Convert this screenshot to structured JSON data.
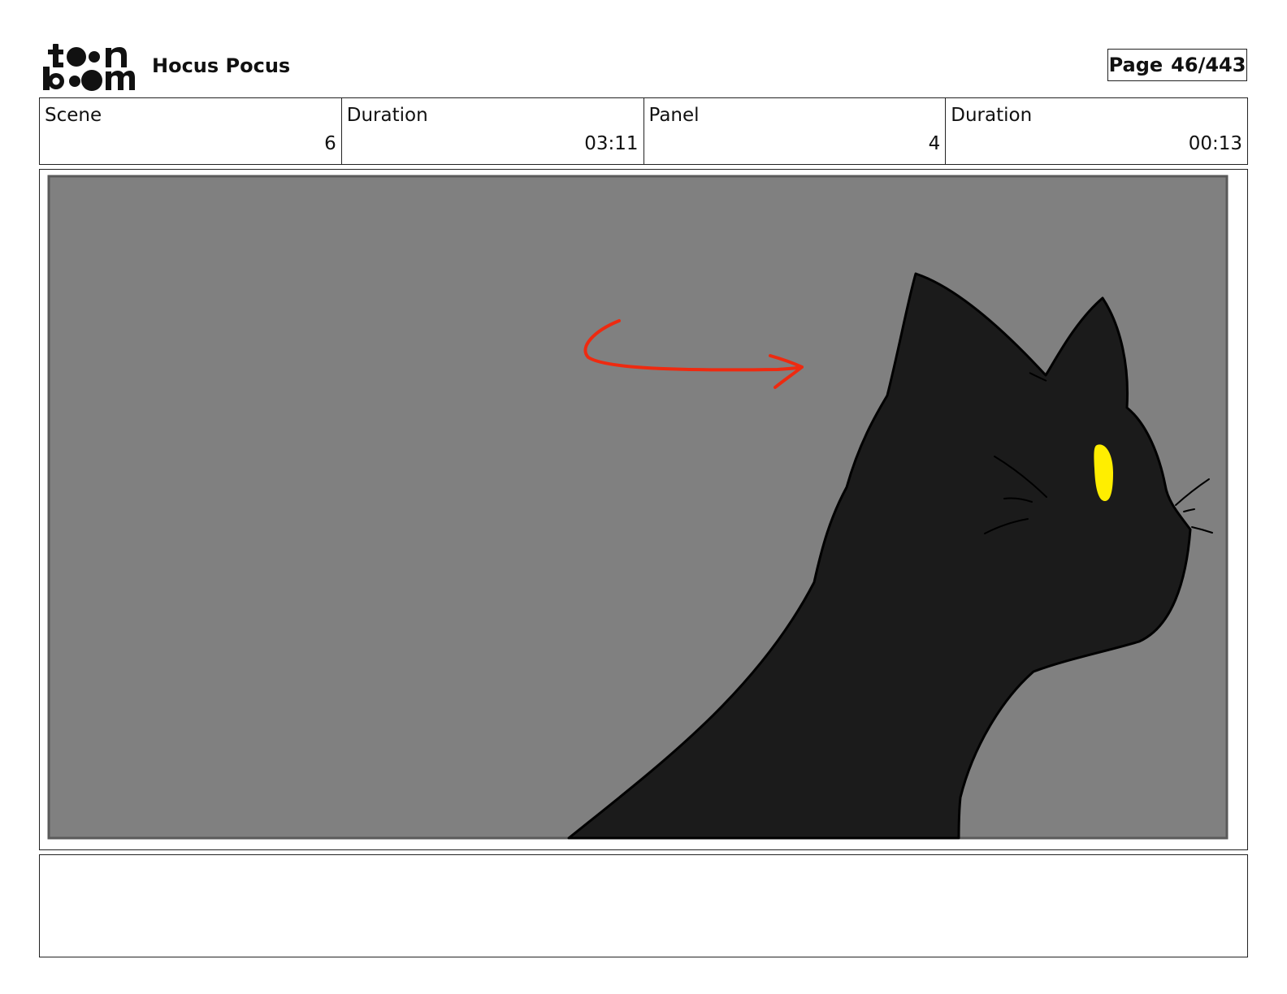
{
  "header": {
    "logo_icon": "toon-boom-logo-icon",
    "project_title": "Hocus Pocus",
    "page_label": "Page",
    "page_number": "46/443"
  },
  "info": [
    {
      "label": "Scene",
      "value": "6"
    },
    {
      "label": "Duration",
      "value": "03:11"
    },
    {
      "label": "Panel",
      "value": "4"
    },
    {
      "label": "Duration",
      "value": "00:13"
    }
  ],
  "panel": {
    "drawing": "black-cat-silhouette",
    "colors": {
      "background": "#808080",
      "cat": "#1b1b1b",
      "eye": "#ffee00",
      "arrow": "#ee2a10"
    }
  },
  "notes": {
    "text": ""
  }
}
